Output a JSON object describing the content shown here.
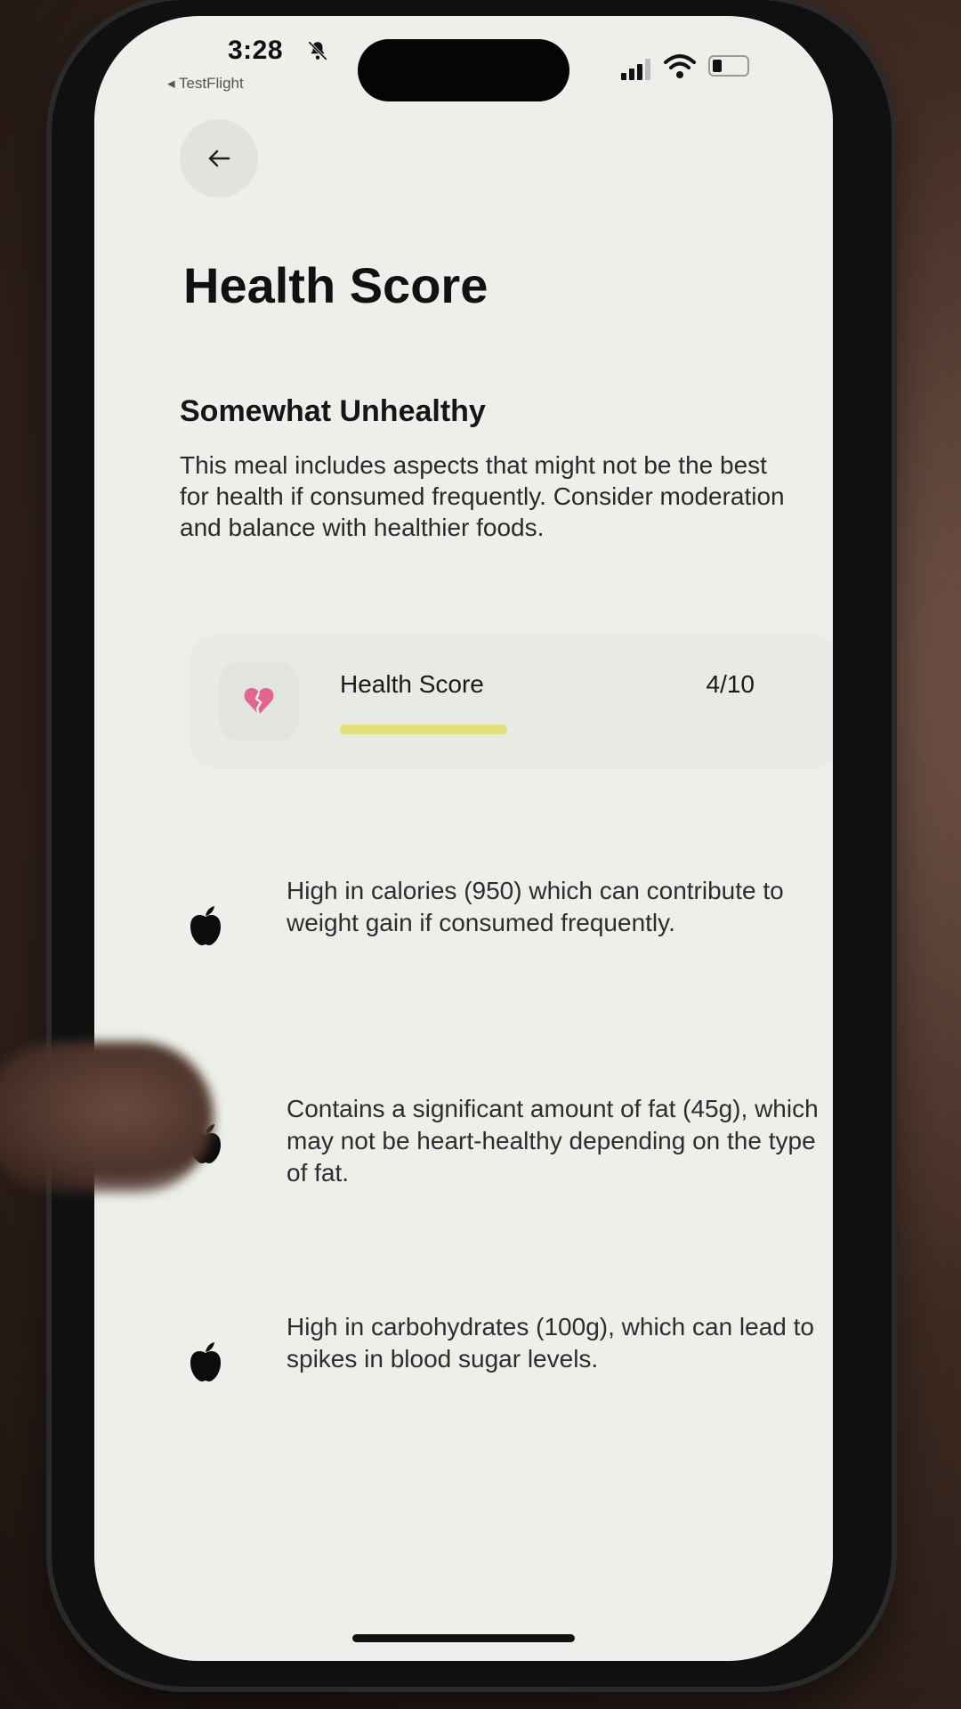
{
  "status_bar": {
    "time": "3:28",
    "back_app_label": "◂ TestFlight"
  },
  "page": {
    "title": "Health Score"
  },
  "rating": {
    "heading": "Somewhat Unhealthy",
    "description": "This meal includes aspects that might not be the best for health if consumed frequently. Consider moderation and balance with healthier foods."
  },
  "score_card": {
    "label": "Health Score",
    "value_text": "4/10",
    "score": 4,
    "max": 10,
    "bar_color": "#e4e07a",
    "icon": "broken-heart-icon"
  },
  "insights": [
    {
      "icon": "apple-icon",
      "text": "High in calories (950) which can contribute to weight gain if consumed frequently."
    },
    {
      "icon": "apple-icon",
      "text": "Contains a significant amount of fat (45g), which may not be heart-healthy depending on the type of fat."
    },
    {
      "icon": "apple-icon",
      "text": "High in carbohydrates (100g), which can lead to spikes in blood sugar levels."
    }
  ]
}
